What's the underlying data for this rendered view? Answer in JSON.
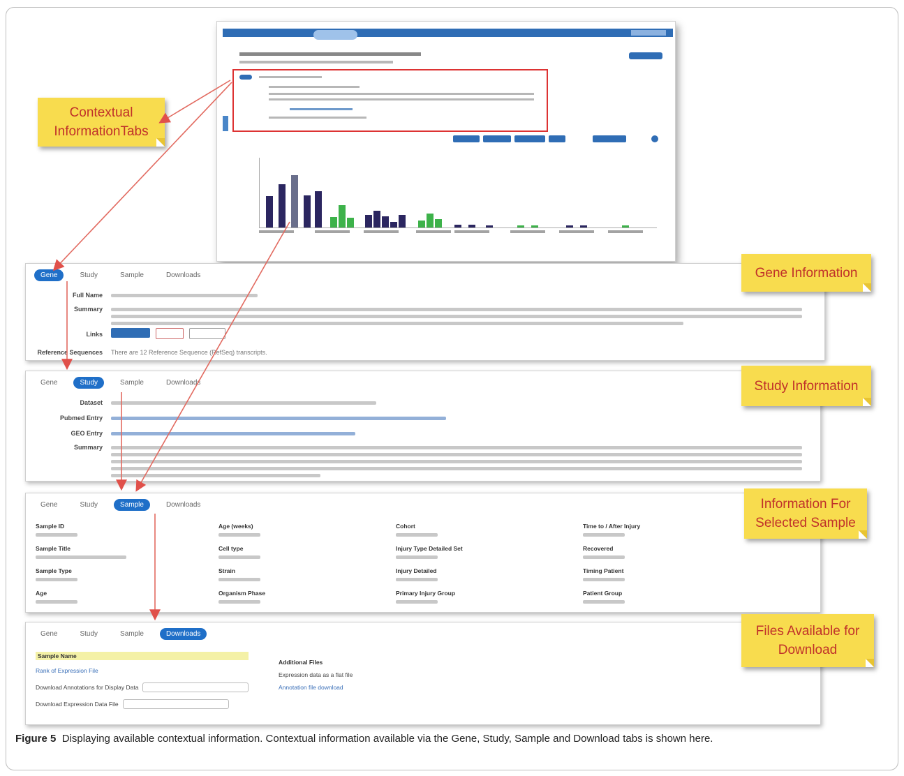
{
  "notes": {
    "contextual_tabs": "Contextual InformationTabs",
    "gene_info": "Gene Information",
    "study_info": "Study Information",
    "sample_info": "Information For Selected Sample",
    "files": "Files Available for Download"
  },
  "tabs": [
    "Gene",
    "Study",
    "Sample",
    "Downloads"
  ],
  "gene_panel": {
    "labels": [
      "Full Name",
      "Summary",
      "Links",
      "Reference Sequences"
    ],
    "reference_text": "There are 12 Reference Sequence (RefSeq) transcripts."
  },
  "study_panel": {
    "labels": [
      "Dataset",
      "Pubmed Entry",
      "GEO Entry",
      "Summary"
    ]
  },
  "sample_panel": {
    "fields": [
      "Sample ID",
      "Age (weeks)",
      "Cohort",
      "Time to / After Injury",
      "Sample Title",
      "Cell type",
      "Injury Type Detailed Set",
      "Recovered",
      "Sample Type",
      "Strain",
      "Injury Detailed",
      "Timing Patient",
      "Age",
      "Organism Phase",
      "Primary Injury Group",
      "Patient Group"
    ]
  },
  "download_panel": {
    "left_items": [
      "Sample Name",
      "Rank of Expression File",
      "Download Annotations for Display Data",
      "Download Expression Data File"
    ],
    "right_title": "Additional Files",
    "right_items": [
      "Expression data as a flat file",
      "Annotation file download"
    ]
  },
  "caption": {
    "label": "Figure 5",
    "text": "Displaying available contextual information. Contextual information available via the Gene, Study, Sample and Download tabs is shown here."
  }
}
